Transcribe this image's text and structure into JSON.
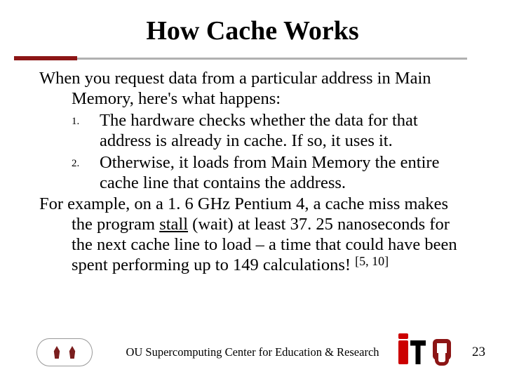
{
  "title": "How Cache Works",
  "intro": "When you request data from a particular address in Main Memory, here's what happens:",
  "items": [
    {
      "num": "1.",
      "text": "The hardware checks whether the data for that address is already in cache. If so, it uses it."
    },
    {
      "num": "2.",
      "text": "Otherwise, it loads from Main Memory the entire cache line that contains the address."
    }
  ],
  "example_pre": "For example, on a 1. 6 GHz Pentium 4, a cache miss makes the program ",
  "example_underlined": "stall",
  "example_post": " (wait) at least 37. 25 nanoseconds for the next cache line to load – a time that could have been spent performing up to 149 calculations! ",
  "refs": "[5, 10]",
  "footer": {
    "center": "OU Supercomputing Center for Education & Research",
    "page": "23",
    "left_logo_name": "oscer-logo",
    "right_logo1_name": "it-logo",
    "right_logo2_name": "ou-logo"
  }
}
